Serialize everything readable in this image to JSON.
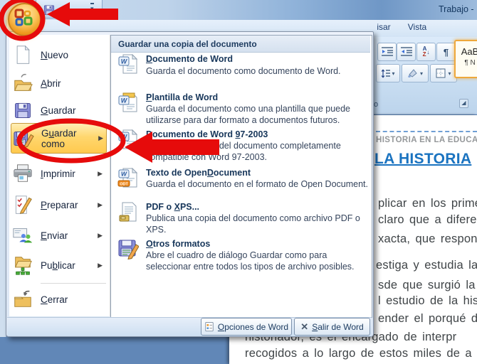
{
  "window": {
    "title_fragment": "Trabajo - "
  },
  "ribbon": {
    "tabs": [
      {
        "label": "isar"
      },
      {
        "label": "Vista"
      }
    ],
    "group_label_fragment": "fo",
    "pilcrow": "¶",
    "sort_a": "A",
    "sort_z": "Z",
    "styles_sample": "AaB",
    "styles_name_fragment": "¶ N",
    "qat_dropdown_glyph": "▾",
    "launcher_glyph": "◢"
  },
  "office_menu": {
    "left_items": [
      {
        "pre": "",
        "accel": "N",
        "post": "uevo",
        "icon": "new-document-icon",
        "has_submenu": false
      },
      {
        "pre": "",
        "accel": "A",
        "post": "brir",
        "icon": "open-folder-icon",
        "has_submenu": false
      },
      {
        "pre": "",
        "accel": "G",
        "post": "uardar",
        "icon": "save-icon",
        "has_submenu": false
      },
      {
        "pre": "G",
        "accel": "u",
        "post": "ardar como",
        "icon": "save-as-icon",
        "has_submenu": true,
        "highlighted": true
      },
      {
        "pre": "",
        "accel": "I",
        "post": "mprimir",
        "icon": "print-icon",
        "has_submenu": true
      },
      {
        "pre": "",
        "accel": "P",
        "post": "reparar",
        "icon": "prepare-icon",
        "has_submenu": true
      },
      {
        "pre": "",
        "accel": "E",
        "post": "nviar",
        "icon": "send-icon",
        "has_submenu": true
      },
      {
        "pre": "Pu",
        "accel": "b",
        "post": "licar",
        "icon": "publish-icon",
        "has_submenu": true
      },
      {
        "pre": "",
        "accel": "C",
        "post": "errar",
        "icon": "close-document-icon",
        "has_submenu": false
      }
    ],
    "submenu_arrow": "▶",
    "submenu": {
      "header": "Guardar una copia del documento",
      "items": [
        {
          "pre": "",
          "accel": "D",
          "post": "ocumento de Word",
          "desc": "Guarda el documento como documento de Word.",
          "icon": "word-document-icon"
        },
        {
          "pre": "",
          "accel": "P",
          "post": "lantilla de Word",
          "desc": "Guarda el documento como una plantilla que puede utilizarse para dar formato a documentos futuros.",
          "icon": "word-template-icon"
        },
        {
          "pre": "Documento de Word ",
          "accel": "9",
          "post": "7-2003",
          "desc": "Guarda una copia del documento completamente compatible con Word 97-2003.",
          "icon": "word-97-document-icon"
        },
        {
          "pre": "Texto de Open",
          "accel": "D",
          "post": "ocument",
          "desc": "Guarda el documento en el formato de Open Document.",
          "icon": "opendocument-icon"
        },
        {
          "pre": "PDF o ",
          "accel": "X",
          "post": "PS...",
          "desc": "Publica una copia del documento como archivo PDF o XPS.",
          "icon": "pdf-xps-icon"
        },
        {
          "pre": "",
          "accel": "O",
          "post": "tros formatos",
          "desc": "Abre el cuadro de diálogo Guardar como para seleccionar entre todos los tipos de archivo posibles.",
          "icon": "other-formats-icon"
        }
      ]
    },
    "footer": {
      "options": {
        "pre": "",
        "accel": "O",
        "post": "pciones de Word"
      },
      "exit": {
        "pre": "",
        "accel": "S",
        "post": "alir de Word"
      },
      "exit_glyph": "✕"
    }
  },
  "document": {
    "header_fragment": "HISTORIA EN LA EDUCACI",
    "title_fragment": "LA HISTORIA",
    "body_fragments": [
      "plicar en los primeros",
      "claro que a diferencia",
      "xacta, que responda a",
      "estiga y estudia la ev",
      "sde que surgió la es",
      "l estudio de la historia",
      "ender el porqué de s"
    ],
    "bottom_fragments": [
      "historiador, es el encargado de interpr",
      "recogidos a lo largo de estos miles de a"
    ]
  },
  "icon_glyphs": {
    "word": "W",
    "odt": "ODT"
  },
  "colors": {
    "annotation_red": "#e60b0b",
    "highlight_orange": "#ffd76e",
    "title_blue": "#1a73c0",
    "canvas_blue": "#6187b7",
    "ribbon_blue": "#d3e4f5",
    "menu_text": "#17365a",
    "styles_selected_border": "#eea83c"
  }
}
